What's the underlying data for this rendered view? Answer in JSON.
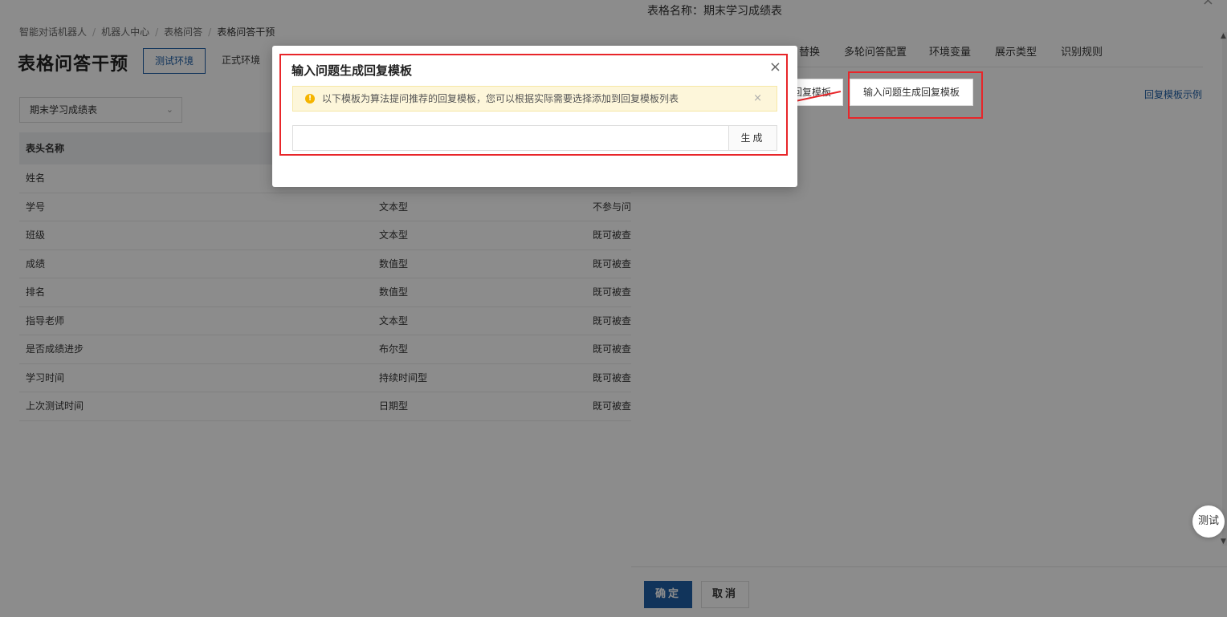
{
  "breadcrumb": [
    "智能对话机器人",
    "机器人中心",
    "表格问答",
    "表格问答干预"
  ],
  "page": {
    "title": "表格问答干预",
    "env_test": "测试环境",
    "env_prod": "正式环境",
    "table_select": "期末学习成绩表"
  },
  "table": {
    "header": "表头名称",
    "rows": [
      {
        "name": "姓名",
        "type": "",
        "mode": ""
      },
      {
        "name": "学号",
        "type": "文本型",
        "mode": "不参与问答"
      },
      {
        "name": "班级",
        "type": "文本型",
        "mode": "既可被查询"
      },
      {
        "name": "成绩",
        "type": "数值型",
        "mode": "既可被查询"
      },
      {
        "name": "排名",
        "type": "数值型",
        "mode": "既可被查询"
      },
      {
        "name": "指导老师",
        "type": "文本型",
        "mode": "既可被查询"
      },
      {
        "name": "是否成绩进步",
        "type": "布尔型",
        "mode": "既可被查询"
      },
      {
        "name": "学习时间",
        "type": "持续时间型",
        "mode": "既可被查询"
      },
      {
        "name": "上次测试时间",
        "type": "日期型",
        "mode": "既可被查询"
      }
    ]
  },
  "drawer": {
    "title": "表格名称：期末学习成绩表",
    "tabs": [
      "替换",
      "多轮问答配置",
      "环境变量",
      "展示类型",
      "识别规则"
    ],
    "btn_template_partial": "回复模板",
    "btn_generate_template": "输入问题生成回复模板",
    "link_example": "回复模板示例",
    "fab_test": "测试",
    "ok": "确定",
    "cancel": "取消"
  },
  "modal": {
    "title": "输入问题生成回复模板",
    "alert": "以下模板为算法提问推荐的回复模板，您可以根据实际需要选择添加到回复模板列表",
    "input_value": "",
    "generate": "生成"
  },
  "colors": {
    "primary": "#1f5fa6",
    "annotation_red": "#e8262a",
    "alert_bg": "#fdf6da",
    "warning": "#f5b400"
  }
}
